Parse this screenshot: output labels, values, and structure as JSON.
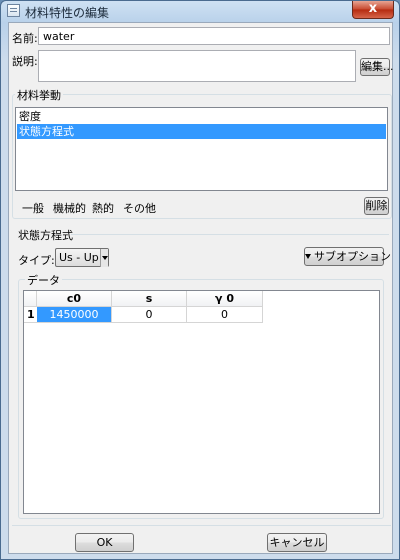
{
  "window": {
    "title": "材料特性の編集",
    "close_label": "x"
  },
  "name_field": {
    "label": "名前:",
    "value": "water"
  },
  "description_field": {
    "label": "説明:",
    "value": "",
    "edit_button": "編集..."
  },
  "material_behavior": {
    "group_title": "材料挙動",
    "items": [
      {
        "label": "密度",
        "selected": false
      },
      {
        "label": "状態方程式",
        "selected": true
      }
    ],
    "menu_tabs": [
      "一般",
      "機械的",
      "熱的",
      "その他"
    ],
    "delete_button": "削除"
  },
  "eos": {
    "section_title": "状態方程式",
    "type_label": "タイプ:",
    "type_value": "Us - Up",
    "suboptions_button": "サブオプション"
  },
  "data": {
    "group_title": "データ",
    "columns": [
      "c0",
      "s",
      "γ 0"
    ],
    "rows": [
      {
        "index": "1",
        "cells": [
          "1450000",
          "0",
          "0"
        ]
      }
    ]
  },
  "footer": {
    "ok_button": "OK",
    "cancel_button": "キャンセル"
  },
  "colors": {
    "selection": "#3399ff",
    "window_frame": "#b9d1ea",
    "client_bg": "#f0f0f0"
  }
}
